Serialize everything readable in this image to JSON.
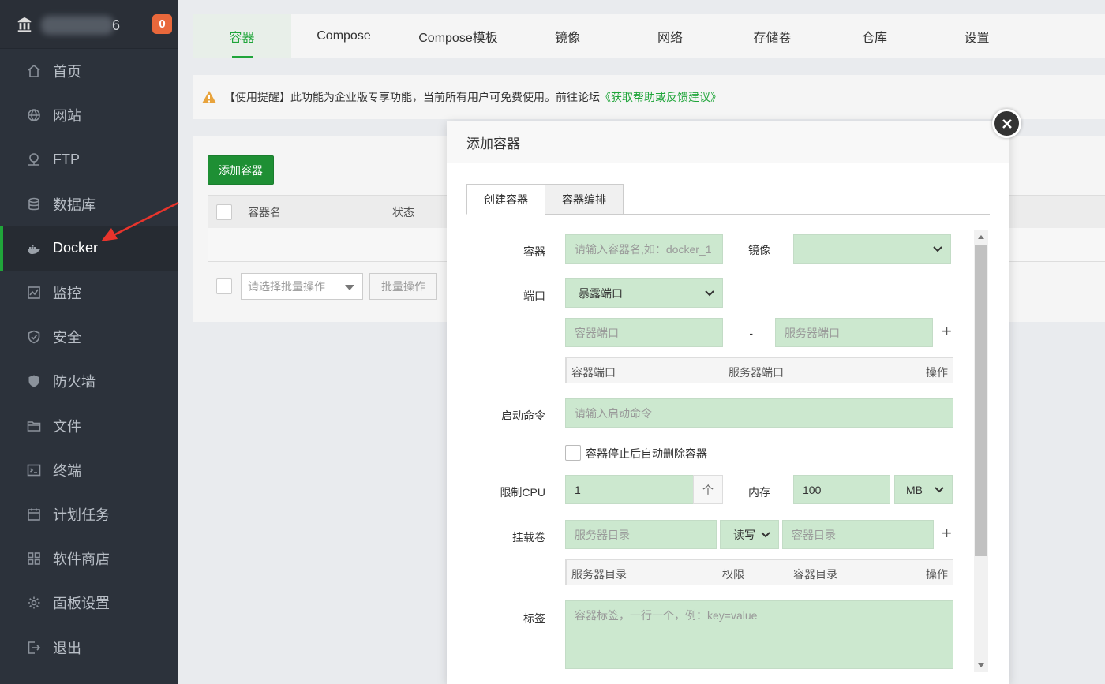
{
  "sidebar": {
    "version_tail": "6",
    "notification_count": "0",
    "items": [
      {
        "label": "首页",
        "icon": "home-icon"
      },
      {
        "label": "网站",
        "icon": "globe-icon"
      },
      {
        "label": "FTP",
        "icon": "ftp-icon"
      },
      {
        "label": "数据库",
        "icon": "database-icon"
      },
      {
        "label": "Docker",
        "icon": "docker-icon",
        "active": true
      },
      {
        "label": "监控",
        "icon": "monitor-icon"
      },
      {
        "label": "安全",
        "icon": "shield-icon"
      },
      {
        "label": "防火墙",
        "icon": "firewall-icon"
      },
      {
        "label": "文件",
        "icon": "folder-icon"
      },
      {
        "label": "终端",
        "icon": "terminal-icon"
      },
      {
        "label": "计划任务",
        "icon": "calendar-icon"
      },
      {
        "label": "软件商店",
        "icon": "grid-icon"
      },
      {
        "label": "面板设置",
        "icon": "gear-icon"
      },
      {
        "label": "退出",
        "icon": "logout-icon"
      }
    ]
  },
  "tabs": [
    "容器",
    "Compose",
    "Compose模板",
    "镜像",
    "网络",
    "存储卷",
    "仓库",
    "设置"
  ],
  "notice": {
    "text": "【使用提醒】此功能为企业版专享功能，当前所有用户可免费使用。前往论坛",
    "link": "《获取帮助或反馈建议》"
  },
  "panel": {
    "add_button": "添加容器",
    "columns": {
      "name": "容器名",
      "status": "状态"
    },
    "batch_placeholder": "请选择批量操作",
    "batch_button": "批量操作"
  },
  "modal": {
    "title": "添加容器",
    "tabs": [
      "创建容器",
      "容器编排"
    ],
    "fields": {
      "container_label": "容器",
      "container_placeholder": "请输入容器名,如：docker_1",
      "image_label": "镜像",
      "port_label": "端口",
      "port_mode": "暴露端口",
      "container_port_placeholder": "容器端口",
      "dash": "-",
      "server_port_placeholder": "服务器端口",
      "port_table": {
        "col1": "容器端口",
        "col2": "服务器端口",
        "col3": "操作"
      },
      "command_label": "启动命令",
      "command_placeholder": "请输入启动命令",
      "auto_remove_label": "容器停止后自动删除容器",
      "cpu_label": "限制CPU",
      "cpu_value": "1",
      "cpu_unit": "个",
      "memory_label": "内存",
      "memory_value": "100",
      "memory_unit": "MB",
      "mount_label": "挂载卷",
      "server_dir_placeholder": "服务器目录",
      "permission": "读写",
      "container_dir_placeholder": "容器目录",
      "mount_table": {
        "col1": "服务器目录",
        "col2": "权限",
        "col3": "容器目录",
        "col4": "操作"
      },
      "tag_label": "标签",
      "tag_placeholder": "容器标签，一行一个，例：key=value",
      "plus": "+"
    }
  },
  "colors": {
    "accent": "#20a53a",
    "sidebar": "#2c323b",
    "input_bg": "#cce8cf",
    "badge": "#e9683b"
  }
}
